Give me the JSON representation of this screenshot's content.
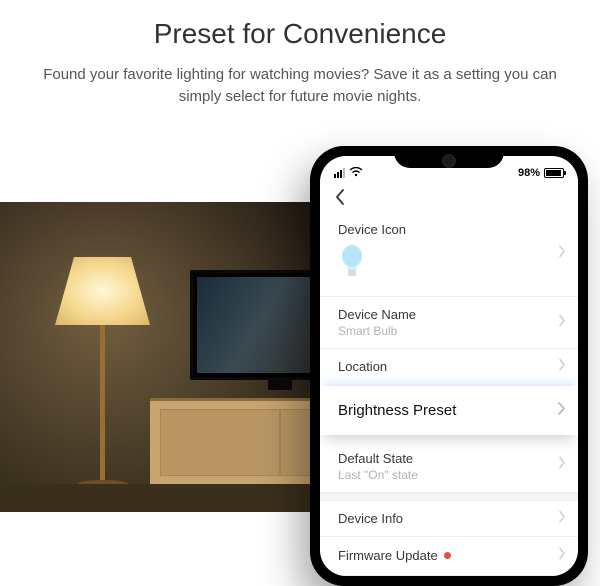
{
  "hero": {
    "title": "Preset for Convenience",
    "subtitle": "Found your favorite lighting for watching movies? Save it as a setting you can simply select for future movie nights."
  },
  "status": {
    "battery_pct": "98%"
  },
  "settings": {
    "device_icon": {
      "label": "Device Icon",
      "icon": "bulb-icon"
    },
    "device_name": {
      "label": "Device Name",
      "value": "Smart Bulb"
    },
    "location": {
      "label": "Location"
    },
    "brightness_preset": {
      "label": "Brightness Preset"
    },
    "default_state": {
      "label": "Default State",
      "value": "Last \"On\" state"
    },
    "device_info": {
      "label": "Device Info"
    },
    "firmware_update": {
      "label": "Firmware Update",
      "has_badge": true
    }
  }
}
